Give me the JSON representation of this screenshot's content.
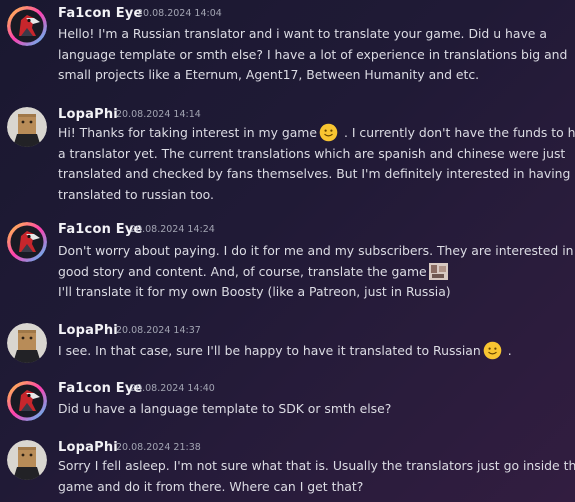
{
  "messages": [
    {
      "author": "Fa1con Eye",
      "timestamp": "20.08.2024 14:04",
      "lines": [
        "Hello! I'm a Russian translator and i want to translate your game. Did u have a",
        "language template or smth else? I have a lot of experience in translations big and",
        "small projects like a Eternum, Agent17, Between Humanity and etc."
      ]
    },
    {
      "author": "LopaPhi",
      "timestamp": "20.08.2024 14:14",
      "lines": [
        "Hi! Thanks for taking interest in my game",
        " . I currently don't have the funds to hire",
        "a translator yet. The current translations which are spanish and chinese were just",
        "translated and checked by fans themselves. But I'm definitely interested in having it",
        "translated to russian too."
      ]
    },
    {
      "author": "Fa1con Eye",
      "timestamp": "20.08.2024 14:24",
      "lines": [
        "Don't worry about paying. I do it for me and my subscribers. They are interested in",
        "good story and content. And, of course, translate the game",
        "I'll translate it for my own Boosty (like a Patreon, just in Russia)"
      ]
    },
    {
      "author": "LopaPhi",
      "timestamp": "20.08.2024 14:37",
      "lines": [
        "I see. In that case, sure I'll be happy to have it translated to Russian",
        " ."
      ]
    },
    {
      "author": "Fa1con Eye",
      "timestamp": "20.08.2024 14:40",
      "lines": [
        "Did u have a language template to SDK or smth else?"
      ]
    },
    {
      "author": "LopaPhi",
      "timestamp": "20.08.2024 21:38",
      "lines": [
        "Sorry I fell asleep. I'm not sure what that is. Usually the translators just go inside the",
        "game and do it from there. Where can I get that?"
      ]
    }
  ]
}
